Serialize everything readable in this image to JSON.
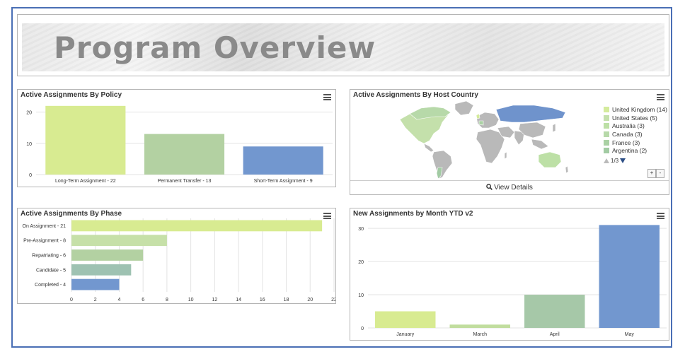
{
  "banner": {
    "title": "Program Overview"
  },
  "policy_chart": {
    "title": "Active Assignments By Policy",
    "chart_data": {
      "type": "bar",
      "categories": [
        "Long-Term Assignment - 22",
        "Permanent Transfer - 13",
        "Short-Term Assignment - 9"
      ],
      "values": [
        22,
        13,
        9
      ],
      "colors": [
        "#d8eb91",
        "#b3d1a2",
        "#7297cf"
      ],
      "yticks": [
        0,
        10,
        20
      ],
      "ylim": [
        0,
        24
      ]
    }
  },
  "country_chart": {
    "title": "Active Assignments By Host Country",
    "legend": [
      {
        "label": "United Kingdom (14)",
        "color": "#d4eb9c"
      },
      {
        "label": "United States (5)",
        "color": "#c4e0ab"
      },
      {
        "label": "Australia (3)",
        "color": "#bde0a6"
      },
      {
        "label": "Canada (3)",
        "color": "#b7d9a9"
      },
      {
        "label": "France (3)",
        "color": "#aad1a4"
      },
      {
        "label": "Argentina (2)",
        "color": "#a2cba3"
      }
    ],
    "pager": "1/3",
    "zoom_in": "+",
    "zoom_out": "-",
    "view_details": "View Details",
    "map_colors": {
      "land": "#b9b9b9",
      "highlight": "#6f93cc",
      "accent": "#bfe3a2"
    }
  },
  "phase_chart": {
    "title": "Active Assignments By Phase",
    "chart_data": {
      "type": "bar",
      "orientation": "horizontal",
      "categories": [
        "On Assignment - 21",
        "Pre-Assignment - 8",
        "Repatriating - 6",
        "Candidate - 5",
        "Completed - 4"
      ],
      "values": [
        21,
        8,
        6,
        5,
        4
      ],
      "colors": [
        "#d8eb91",
        "#c6e0a8",
        "#b3d1a2",
        "#9ec2b2",
        "#7297cf"
      ],
      "xticks": [
        0,
        2,
        4,
        6,
        8,
        10,
        12,
        14,
        16,
        18,
        20,
        22
      ],
      "xlim": [
        0,
        22
      ]
    }
  },
  "month_chart": {
    "title": "New Assignments by Month YTD v2",
    "chart_data": {
      "type": "bar",
      "categories": [
        "January",
        "March",
        "April",
        "May"
      ],
      "values": [
        5,
        1,
        10,
        31
      ],
      "colors": [
        "#d8eb91",
        "#c1dd9e",
        "#a6c8a8",
        "#7297cf"
      ],
      "yticks": [
        0,
        10,
        20,
        30
      ],
      "ylim": [
        0,
        33
      ]
    }
  }
}
